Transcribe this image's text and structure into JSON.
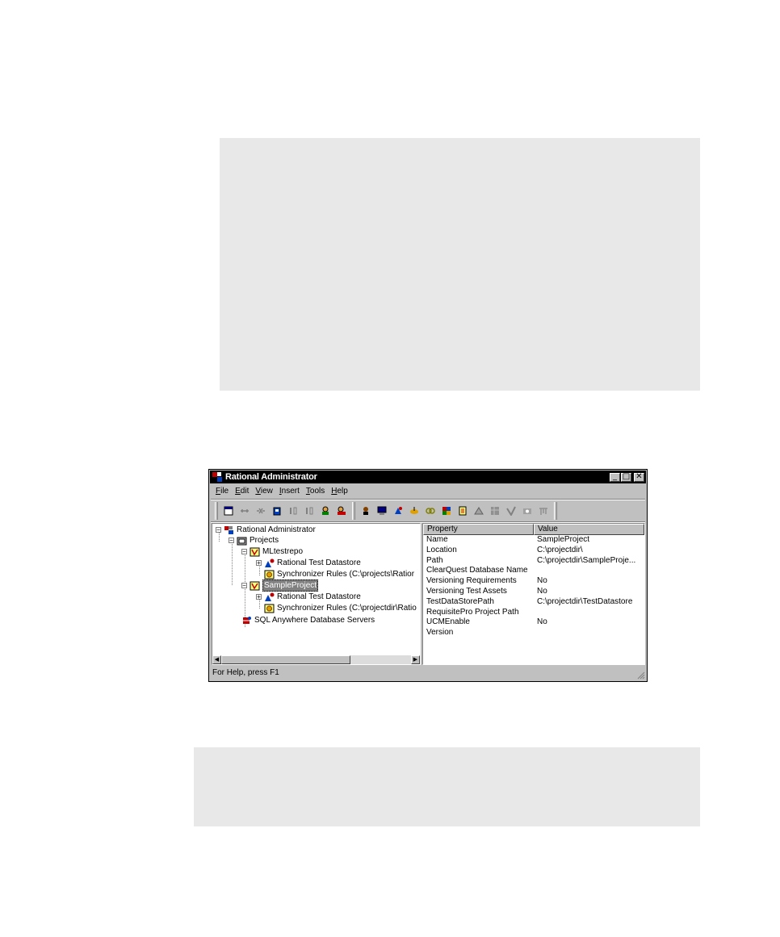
{
  "window": {
    "title": "Rational Administrator",
    "minimize": "_",
    "maximize": "□",
    "close": "✕"
  },
  "menu": [
    {
      "key": "F",
      "rest": "ile"
    },
    {
      "key": "E",
      "rest": "dit"
    },
    {
      "key": "V",
      "rest": "iew"
    },
    {
      "key": "I",
      "rest": "nsert"
    },
    {
      "key": "T",
      "rest": "ools"
    },
    {
      "key": "H",
      "rest": "elp"
    }
  ],
  "toolbar_icons": [
    "properties-icon",
    "connect-icon",
    "disconnect-icon",
    "new-project-icon",
    "pause-icon",
    "pause-icon",
    "user-icon",
    "project-manager-icon",
    "admin-user-icon",
    "computer-icon",
    "datastore-icon",
    "tool-icon",
    "link-icon",
    "puzzle-icon",
    "document-icon",
    "pyramid-icon",
    "grid-icon",
    "checkmark-icon",
    "camera-icon",
    "chart-icon"
  ],
  "tree": {
    "root": "Rational Administrator",
    "projects": "Projects",
    "ml_testrepo": "MLtestrepo",
    "rtd1": "Rational Test Datastore",
    "sync1": "Synchronizer Rules (C:\\projects\\Ratior",
    "sample": "SampleProject",
    "rtd2": "Rational Test Datastore",
    "sync2": "Synchronizer Rules (C:\\projectdir\\Ratio",
    "sql": "SQL Anywhere Database Servers"
  },
  "list": {
    "col_property": "Property",
    "col_value": "Value",
    "rows": [
      {
        "property": "Name",
        "value": "SampleProject"
      },
      {
        "property": "Location",
        "value": "C:\\projectdir\\"
      },
      {
        "property": "Path",
        "value": "C:\\projectdir\\SampleProje..."
      },
      {
        "property": "ClearQuest Database Name",
        "value": ""
      },
      {
        "property": "Versioning Requirements",
        "value": "No"
      },
      {
        "property": "Versioning Test Assets",
        "value": "No"
      },
      {
        "property": "TestDataStorePath",
        "value": "C:\\projectdir\\TestDatastore"
      },
      {
        "property": "RequisitePro Project Path",
        "value": ""
      },
      {
        "property": "UCMEnable",
        "value": "No"
      },
      {
        "property": "Version",
        "value": ""
      }
    ]
  },
  "status": "For Help, press F1",
  "colors": {
    "titlebar": "#000000",
    "face": "#c0c0c0",
    "highlight": "#808080"
  }
}
